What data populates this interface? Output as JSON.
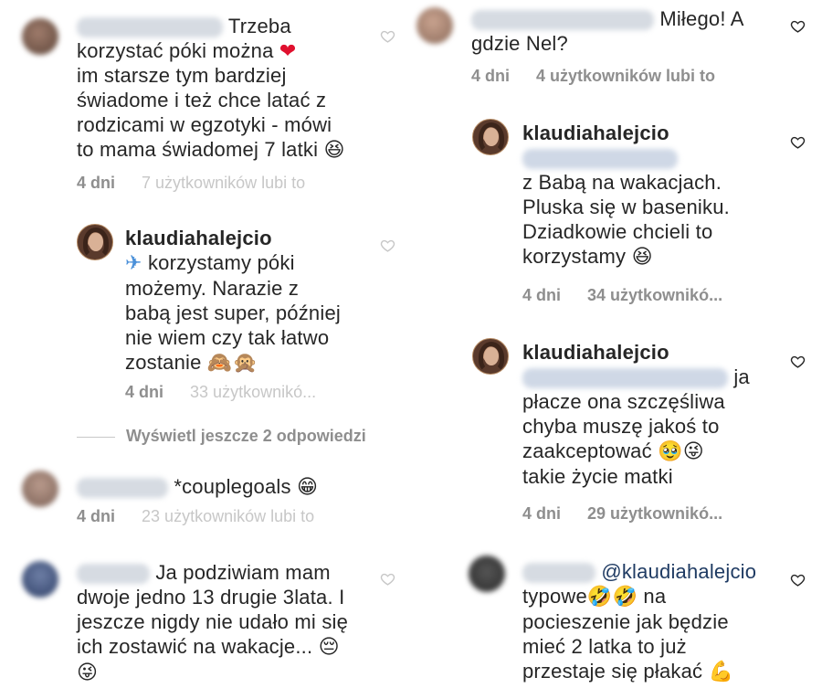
{
  "left": {
    "c1": {
      "text_lines": [
        "Trzeba",
        "korzystać póki można",
        "im starsze tym bardziej",
        "świadome i też chce latać z",
        "rodzicami w egzotyki - mówi",
        "to mama świadomej 7 latki"
      ],
      "emoji_heart": "❤",
      "emoji_end": "😆",
      "time": "4 dni",
      "likes": "7 użytkowników lubi to"
    },
    "r1": {
      "username": "klaudiahalejcio",
      "emoji_plane": "✈",
      "text_lines": [
        "korzystamy póki",
        "możemy. Narazie z",
        "babą jest super, później",
        "nie wiem czy tak łatwo",
        "zostanie"
      ],
      "emoji_end": "🙈🙊",
      "time": "4 dni",
      "likes": "33 użytkownikó..."
    },
    "more_replies": "Wyświetl jeszcze 2 odpowiedzi",
    "c2": {
      "text": "*couplegoals",
      "emoji_end": "😁",
      "time": "4 dni",
      "likes": "23 użytkowników lubi to"
    },
    "c3": {
      "text_lines": [
        "Ja podziwiam mam",
        "dwoje jedno 13 drugie 3lata. I",
        "jeszcze nigdy nie udało mi się",
        "ich zostawić na wakacje..."
      ],
      "emoji_pensive": "😔",
      "emoji_tongue": "😜"
    }
  },
  "right": {
    "c1": {
      "text_first": "Miłego! A",
      "text_second": "gdzie Nel?",
      "time": "4 dni",
      "likes": "4 użytkowników lubi to"
    },
    "r1": {
      "username": "klaudiahalejcio",
      "text_lines": [
        "z Babą na wakacjach.",
        "Pluska się w baseniku.",
        "Dziadkowie chcieli to",
        "korzystamy"
      ],
      "emoji_end": "😆",
      "time": "4 dni",
      "likes": "34 użytkownikó..."
    },
    "r2": {
      "username": "klaudiahalejcio",
      "text_first": "ja",
      "text_lines": [
        "płacze ona szczęśliwa",
        "chyba muszę jakoś to",
        "zaakceptować",
        "takie życie matki"
      ],
      "emoji_mid": "🥹😜",
      "time": "4 dni",
      "likes": "29 użytkownikó..."
    },
    "c2": {
      "mention": "@klaudiahalejcio",
      "text_typowe": "typowe",
      "emoji_rofl": "🤣🤣",
      "text_na": "na",
      "text_lines": [
        "pocieszenie jak będzie",
        "mieć 2 latka to już",
        "przestaje się płakać"
      ],
      "emoji_flex": "💪"
    }
  },
  "colors": {
    "meta": "#8e8e8e",
    "text": "#262626",
    "mention": "#1f3b63",
    "heart": "#e0102e"
  },
  "icons": [
    "heart-outline-icon"
  ]
}
